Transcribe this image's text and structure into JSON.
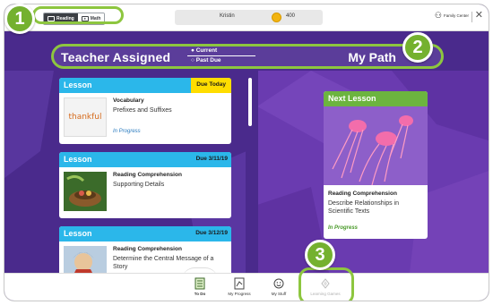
{
  "topbar": {
    "subjects": [
      {
        "label": "Reading",
        "active": true
      },
      {
        "label": "Math",
        "active": false
      }
    ],
    "user_name": "Kristin",
    "coins": "400",
    "family_center": "Family Center",
    "close_glyph": "✕"
  },
  "header": {
    "left_title": "Teacher Assigned",
    "toggle": {
      "current": "● Current",
      "past_due": "○ Past Due"
    },
    "right_title": "My Path"
  },
  "callouts": [
    "1",
    "2",
    "3"
  ],
  "lessons": [
    {
      "type": "Lesson",
      "due": "Due Today",
      "kind": "Vocabulary",
      "topic": "Prefixes and Suffixes",
      "status": "In Progress",
      "thumb_text": "thankful"
    },
    {
      "type": "Lesson",
      "due": "Due 3/11/19",
      "kind": "Reading Comprehension",
      "topic": "Supporting Details",
      "status": ""
    },
    {
      "type": "Lesson",
      "due": "Due 3/12/19",
      "kind": "Reading Comprehension",
      "topic": "Determine the Central Message of a Story",
      "status": ""
    }
  ],
  "next_lesson": {
    "header": "Next Lesson",
    "kind": "Reading Comprehension",
    "topic": "Describe Relationships in Scientific Texts",
    "status": "In Progress"
  },
  "nav": [
    {
      "label": "To Do",
      "icon": "todo-icon"
    },
    {
      "label": "My Progress",
      "icon": "progress-icon"
    },
    {
      "label": "My Stuff",
      "icon": "smiley-icon"
    },
    {
      "label": "Learning Games",
      "icon": "games-icon"
    }
  ],
  "colors": {
    "accent_green": "#8dc63f",
    "lesson_blue": "#2bb7ea",
    "due_today_yellow": "#ffdd00",
    "background_purple": "#4a2a8c",
    "next_lesson_green": "#6cb43f"
  }
}
